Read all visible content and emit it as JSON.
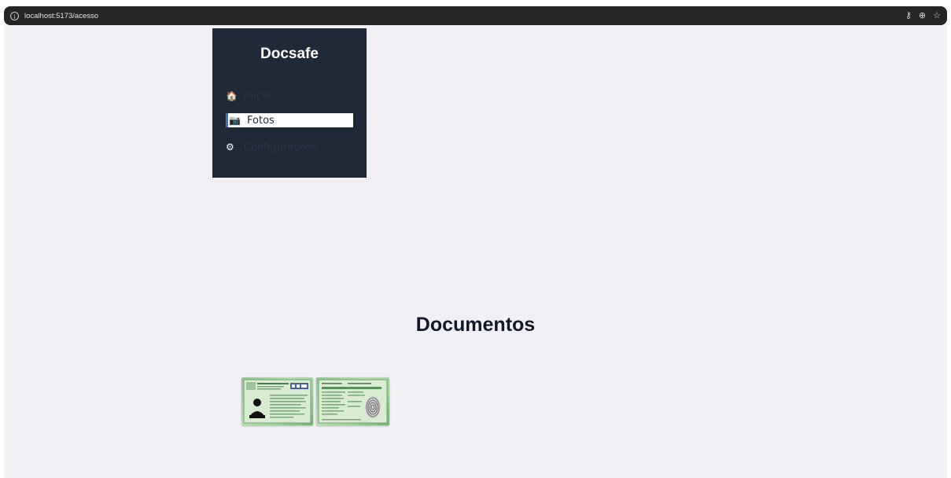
{
  "browser": {
    "url": "localhost:5173/acesso",
    "icons": [
      "site-info-icon",
      "password-key-icon",
      "zoom-icon",
      "bookmark-star-icon"
    ]
  },
  "sidebar": {
    "brand": "Docsafe",
    "items": [
      {
        "icon": "house-icon",
        "glyph": "🏠",
        "label": "Início",
        "active": false
      },
      {
        "icon": "camera-icon",
        "glyph": "📷",
        "label": "Fotos",
        "active": true
      },
      {
        "icon": "gear-icon",
        "glyph": "⚙",
        "label": "Configurações",
        "active": false
      }
    ]
  },
  "main": {
    "title": "Documentos",
    "documents": [
      {
        "name": "id-card-front"
      },
      {
        "name": "id-card-back"
      }
    ]
  },
  "colors": {
    "sidebar_bg": "#1f2938",
    "page_bg": "#f1f0f5",
    "active_accent": "#3a6fd8"
  }
}
